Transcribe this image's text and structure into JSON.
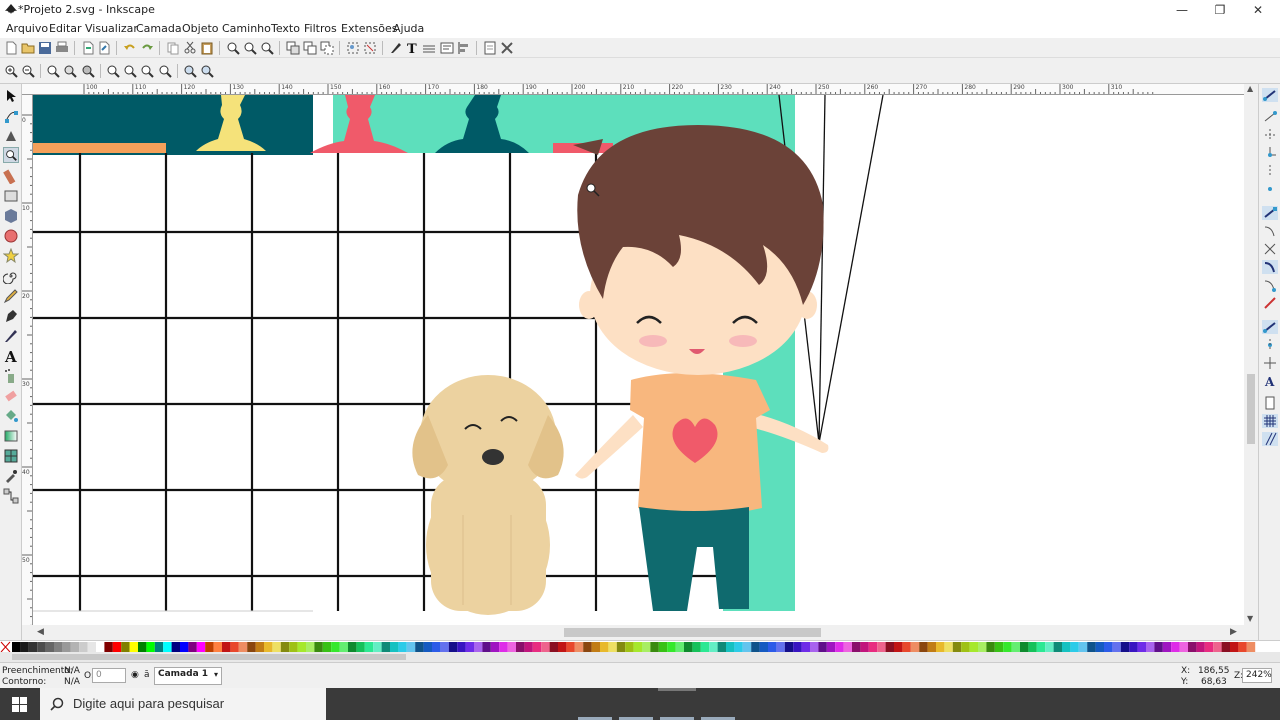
{
  "window": {
    "title": "*Projeto 2.svg - Inkscape",
    "minimize": "—",
    "restore": "❐",
    "close": "✕"
  },
  "menu": [
    "Arquivo",
    "Editar",
    "Visualizar",
    "Camada",
    "Objeto",
    "Caminho",
    "Texto",
    "Filtros",
    "Extensões",
    "Ajuda"
  ],
  "ruler_h_ticks": [
    "100",
    "110",
    "120",
    "130",
    "140",
    "150",
    "160",
    "170",
    "180",
    "190",
    "200",
    "210",
    "220",
    "230",
    "240",
    "250",
    "260",
    "270",
    "280",
    "290",
    "300",
    "310"
  ],
  "ruler_v_ticks": [
    "0",
    "10",
    "20",
    "30",
    "40",
    "50"
  ],
  "status": {
    "fill_label": "Preenchimento:",
    "fill_value": "N/A",
    "stroke_label": "Contorno:",
    "stroke_value": "N/A",
    "opacity_label": "O:",
    "opacity_value": "0",
    "layer_value": "Camada 1",
    "x_label": "X:",
    "x_value": "186,55",
    "y_label": "Y:",
    "y_value": "68,63",
    "zoom_label": "Z:",
    "zoom_value": "242%"
  },
  "taskbar": {
    "search_placeholder": "Digite aqui para pesquisar"
  },
  "colors": {
    "teal_dark": "#005a66",
    "mint": "#5ddfbc",
    "yellow": "#f5e27a",
    "red": "#f05a6a",
    "orange": "#f4a05a",
    "hair": "#6b4238",
    "skin": "#fde0c4",
    "shirt": "#f8b77e",
    "pants": "#0f6a6e",
    "dog": "#ecd2a0"
  }
}
